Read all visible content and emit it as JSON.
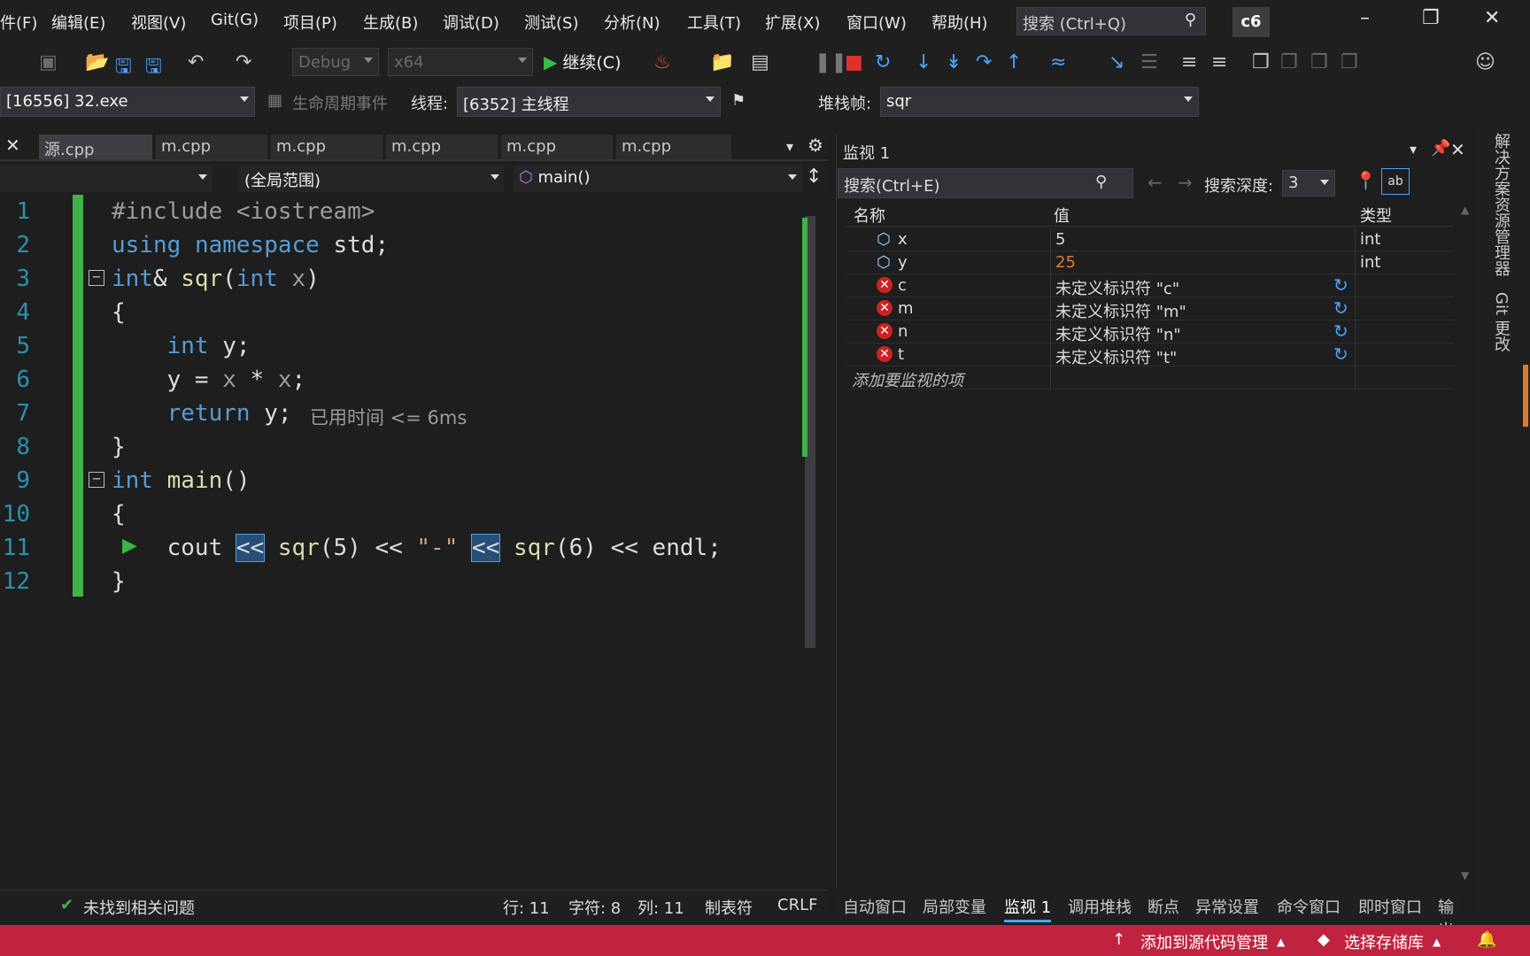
{
  "menu": {
    "items": [
      "件(F)",
      "编辑(E)",
      "视图(V)",
      "Git(G)",
      "项目(P)",
      "生成(B)",
      "调试(D)",
      "测试(S)",
      "分析(N)",
      "工具(T)",
      "扩展(X)",
      "窗口(W)",
      "帮助(H)"
    ],
    "search_label": "搜索 (Ctrl+Q)",
    "solution_badge": "c6"
  },
  "toolbar": {
    "config": "Debug",
    "platform": "x64",
    "continue_label": "继续(C)"
  },
  "debug_bar": {
    "process": "[16556] 32.exe",
    "lifecycle_label": "生命周期事件",
    "thread_label": "线程:",
    "thread_value": "[6352] 主线程",
    "stack_label": "堆栈帧:",
    "stack_value": "sqr"
  },
  "editor": {
    "tabs": [
      "源.cpp",
      "m.cpp",
      "m.cpp",
      "m.cpp",
      "m.cpp",
      "m.cpp"
    ],
    "scope": "(全局范围)",
    "function": "main()",
    "line_numbers": [
      "1",
      "2",
      "3",
      "4",
      "5",
      "6",
      "7",
      "8",
      "9",
      "10",
      "11",
      "12"
    ],
    "perf_tip": "已用时间 <= 6ms"
  },
  "status_editor": {
    "issues": "未找到相关问题",
    "line": "行: 11",
    "char": "字符: 8",
    "col": "列: 11",
    "tabs": "制表符",
    "eol": "CRLF"
  },
  "watch": {
    "title": "监视 1",
    "search_placeholder": "搜索(Ctrl+E)",
    "depth_label": "搜索深度:",
    "depth_value": "3",
    "columns": [
      "名称",
      "值",
      "类型"
    ],
    "rows": [
      {
        "name": "x",
        "value": "5",
        "type": "int",
        "kind": "var"
      },
      {
        "name": "y",
        "value": "25",
        "type": "int",
        "kind": "var"
      },
      {
        "name": "c",
        "value": "未定义标识符 \"c\"",
        "type": "",
        "kind": "error"
      },
      {
        "name": "m",
        "value": "未定义标识符 \"m\"",
        "type": "",
        "kind": "error"
      },
      {
        "name": "n",
        "value": "未定义标识符 \"n\"",
        "type": "",
        "kind": "error"
      },
      {
        "name": "t",
        "value": "未定义标识符 \"t\"",
        "type": "",
        "kind": "error"
      }
    ],
    "add_item": "添加要监视的项"
  },
  "bottom_tabs": [
    "自动窗口",
    "局部变量",
    "监视 1",
    "调用堆栈",
    "断点",
    "异常设置",
    "命令窗口",
    "即时窗口",
    "输出"
  ],
  "right_rail": [
    "解决方案资源管理器",
    "Git 更改"
  ],
  "statusbar": {
    "source_control": "添加到源代码管理",
    "repo": "选择存储库"
  },
  "colors": {
    "status_bar": "#c0233e",
    "keyword": "#569cd6",
    "changed_value": "#e07a3a",
    "change_indicator": "#3fb24a"
  }
}
